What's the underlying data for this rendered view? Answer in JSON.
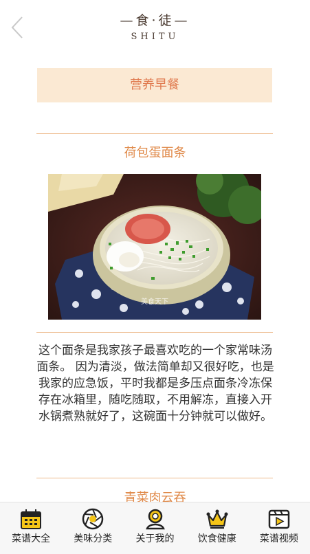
{
  "header": {
    "logo_main": "—食·徒—",
    "logo_sub": "SHITU"
  },
  "section": {
    "title": "营养早餐"
  },
  "recipes": [
    {
      "title": "荷包蛋面条",
      "image_watermark": "美食天下",
      "description": "这个面条是我家孩子最喜欢吃的一个家常味汤面条。 因为清淡，做法简单却又很好吃，也是我家的应急饭，平时我都是多压点面条冷冻保存在冰箱里，随吃随取，不用解冻，直接入开水锅煮熟就好了，这碗面十分钟就可以做好。"
    },
    {
      "title": "青菜肉云吞"
    }
  ],
  "tabbar": {
    "items": [
      {
        "label": "菜谱大全",
        "icon": "calendar-icon"
      },
      {
        "label": "美味分类",
        "icon": "aperture-icon"
      },
      {
        "label": "关于我的",
        "icon": "user-icon"
      },
      {
        "label": "饮食健康",
        "icon": "crown-icon"
      },
      {
        "label": "菜谱视频",
        "icon": "video-icon"
      }
    ]
  },
  "colors": {
    "accent": "#e08a4a",
    "section_bg": "#fbe9d3",
    "icon_yellow": "#f5c518",
    "icon_dark": "#222222"
  }
}
